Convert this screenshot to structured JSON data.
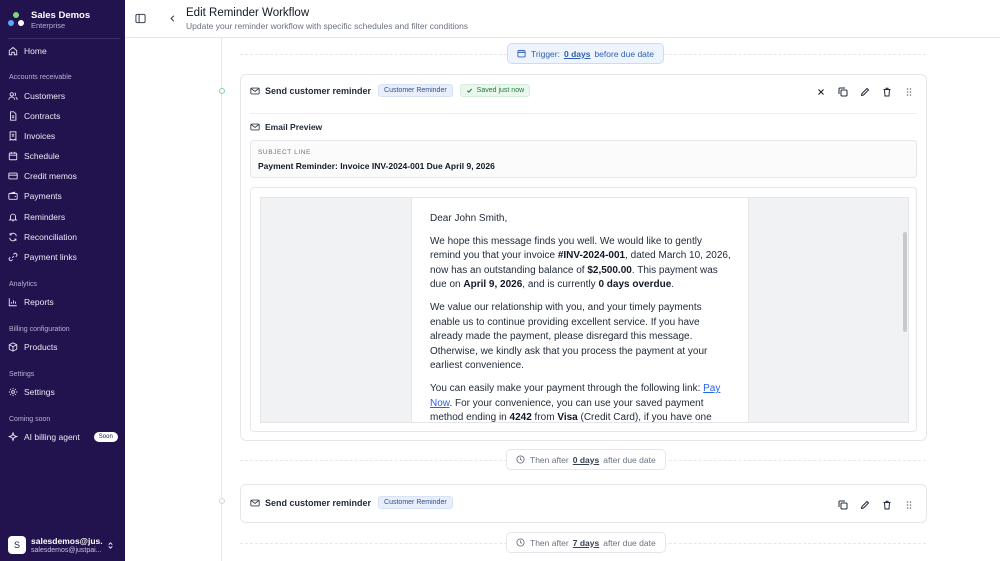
{
  "brand": {
    "name": "Sales Demos",
    "plan": "Enterprise"
  },
  "nav": {
    "home": "Home",
    "section_ar": "Accounts receivable",
    "customers": "Customers",
    "contracts": "Contracts",
    "invoices": "Invoices",
    "schedule": "Schedule",
    "credit_memos": "Credit memos",
    "payments": "Payments",
    "reminders": "Reminders",
    "reconciliation": "Reconciliation",
    "payment_links": "Payment links",
    "section_analytics": "Analytics",
    "reports": "Reports",
    "section_billing": "Billing configuration",
    "products": "Products",
    "section_settings": "Settings",
    "settings": "Settings",
    "section_coming": "Coming soon",
    "ai_agent": "AI billing agent",
    "soon_badge": "Soon"
  },
  "user": {
    "initial": "S",
    "name": "salesdemos@jus...",
    "email": "salesdemos@justpai..."
  },
  "header": {
    "title": "Edit Reminder Workflow",
    "subtitle": "Update your reminder workflow with specific schedules and filter conditions"
  },
  "trigger": {
    "label": "Trigger:",
    "days": "0 days",
    "suffix": "before due date"
  },
  "step1": {
    "title": "Send customer reminder",
    "tag": "Customer Reminder",
    "saved": "Saved just now",
    "preview_title": "Email Preview",
    "subject_label": "SUBJECT LINE",
    "subject_value": "Payment Reminder: Invoice INV-2024-001 Due April 9, 2026",
    "email": {
      "greeting": "Dear John Smith,",
      "p1_a": "We hope this message finds you well. We would like to gently remind you that your invoice ",
      "p1_invoice": "#INV-2024-001",
      "p1_b": ", dated March 10, 2026, now has an outstanding balance of ",
      "p1_amount": "$2,500.00",
      "p1_c": ". This payment was due on ",
      "p1_due": "April 9, 2026",
      "p1_d": ", and is currently ",
      "p1_overdue": "0 days overdue",
      "p1_e": ".",
      "p2": "We value our relationship with you, and your timely payments enable us to continue providing excellent service. If you have already made the payment, please disregard this message. Otherwise, we kindly ask that you process the payment at your earliest convenience.",
      "p3_a": "You can easily make your payment through the following link: ",
      "p3_link": "Pay Now",
      "p3_b": ". For your convenience, you can use your saved payment method ending in ",
      "p3_card": "4242",
      "p3_c": " from ",
      "p3_brand": "Visa",
      "p3_d": " (Credit Card), if you have one saved. If not, you may opt for a different method, as we support various payment options."
    }
  },
  "then1": {
    "prefix": "Then after",
    "days": "0 days",
    "suffix": "after due date"
  },
  "step2": {
    "title": "Send customer reminder",
    "tag": "Customer Reminder"
  },
  "then2": {
    "prefix": "Then after",
    "days": "7 days",
    "suffix": "after due date"
  },
  "colors": {
    "sidebar": "#22124d",
    "accent_blue": "#2f5fb3",
    "saved_green": "#1f7a3d"
  }
}
